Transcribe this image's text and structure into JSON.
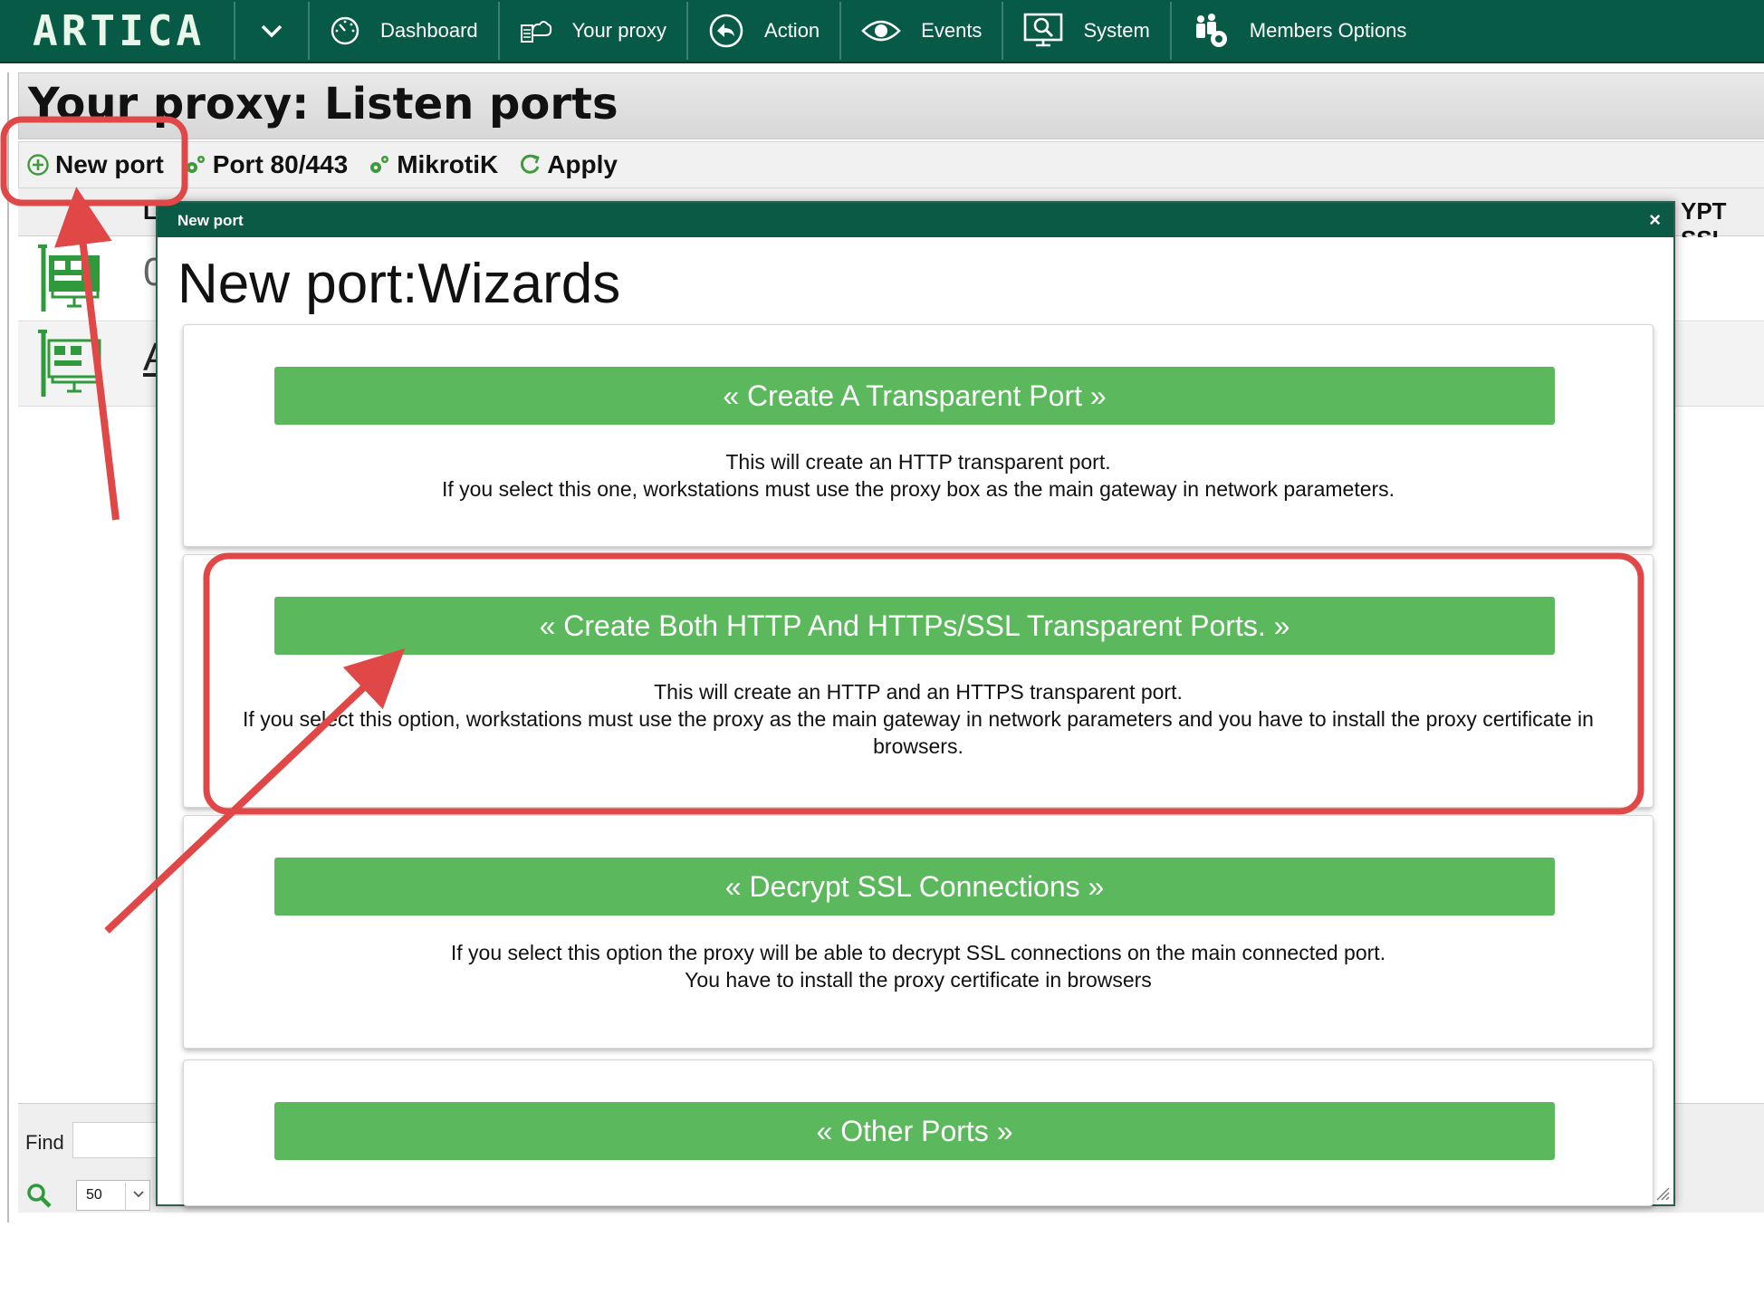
{
  "app": {
    "logo": "ARTICA"
  },
  "nav": {
    "items": [
      {
        "label": "Dashboard",
        "icon": "dashboard-gauge-icon"
      },
      {
        "label": "Your proxy",
        "icon": "proxy-cloud-icon"
      },
      {
        "label": "Action",
        "icon": "back-arrow-icon"
      },
      {
        "label": "Events",
        "icon": "eye-icon"
      },
      {
        "label": "System",
        "icon": "monitor-search-icon"
      },
      {
        "label": "Members Options",
        "icon": "members-gear-icon"
      }
    ]
  },
  "page": {
    "title": "Your proxy: Listen ports",
    "toolbar": {
      "new_port": "New port",
      "port_80_443": "Port 80/443",
      "mikrotik": "MikrotiK",
      "apply": "Apply"
    },
    "grid": {
      "header_left": "LI",
      "header_right": "YPT SSL",
      "rows": [
        {
          "text": "0"
        },
        {
          "text": "A"
        }
      ]
    },
    "footer": {
      "find_label": "Find",
      "page_size": "50"
    }
  },
  "modal": {
    "title": "New port",
    "close": "×",
    "heading": "New port:Wizards",
    "cards": [
      {
        "button": "« Create A Transparent Port »",
        "lines": [
          "This will create an HTTP transparent port.",
          "If you select this one, workstations must use the proxy box as the main gateway in network parameters."
        ]
      },
      {
        "button": "« Create Both HTTP And HTTPs/SSL Transparent Ports. »",
        "lines": [
          "This will create an HTTP and an HTTPS transparent port.",
          "If you select this option, workstations must use the proxy as the main gateway in network parameters and you have to install the proxy certificate in browsers."
        ]
      },
      {
        "button": "« Decrypt SSL Connections »",
        "lines": [
          "If you select this option the proxy will be able to decrypt SSL connections on the main connected port.",
          "You have to install the proxy certificate in browsers"
        ]
      },
      {
        "button": "« Other Ports »",
        "lines": []
      }
    ]
  },
  "colors": {
    "nav_bg": "#075a45",
    "wizard_button": "#5cb85c",
    "annotation_red": "#e04848"
  }
}
